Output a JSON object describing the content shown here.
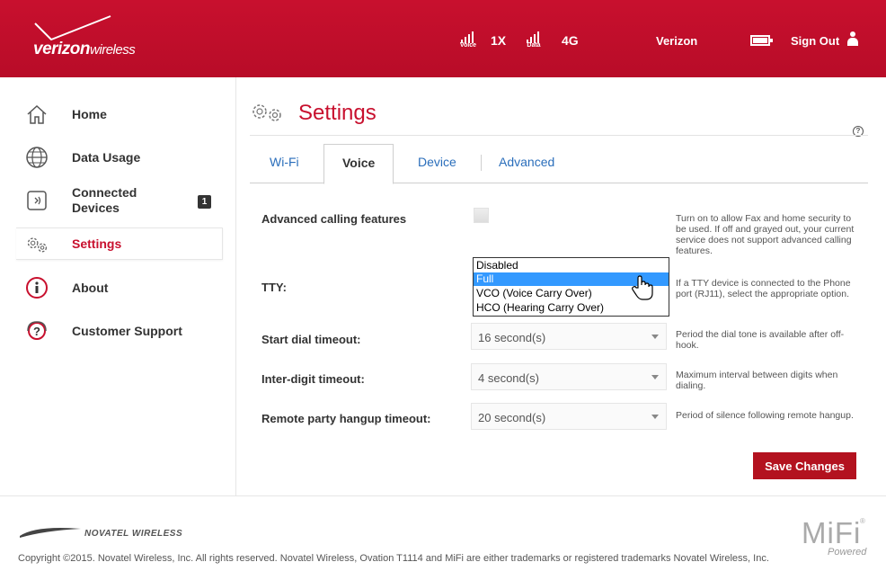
{
  "header": {
    "brand_bold": "verizon",
    "brand_light": "wireless",
    "voice_label": "Voice",
    "voice_network": "1X",
    "data_label": "Data",
    "data_network": "4G",
    "carrier": "Verizon",
    "sign_out": "Sign Out",
    "accent_color": "#c8102e"
  },
  "sidebar": {
    "items": [
      {
        "label": "Home",
        "icon": "home-icon"
      },
      {
        "label": "Data Usage",
        "icon": "globe-icon"
      },
      {
        "label": "Connected\nDevices",
        "icon": "devices-icon"
      },
      {
        "label": "Settings",
        "icon": "gears-icon",
        "active": true
      },
      {
        "label": "About",
        "icon": "info-icon"
      },
      {
        "label": "Customer Support",
        "icon": "support-icon"
      }
    ],
    "connected_count": "1"
  },
  "main": {
    "title": "Settings",
    "help": "?",
    "tabs": [
      {
        "label": "Wi-Fi"
      },
      {
        "label": "Voice",
        "active": true
      },
      {
        "label": "Device"
      },
      {
        "label": "Advanced"
      }
    ],
    "rows": {
      "advanced": {
        "label": "Advanced calling features",
        "help": "Turn on to allow Fax and home security to be used. If off and grayed out, your current service does not support advanced calling features.",
        "checked": false
      },
      "tty": {
        "label": "TTY:",
        "help": "If a TTY device is connected to the Phone port (RJ11), select the appropriate option.",
        "options": [
          "Disabled",
          "Full",
          "VCO (Voice Carry Over)",
          "HCO (Hearing Carry Over)"
        ],
        "highlighted": "Full"
      },
      "start_dial": {
        "label": "Start dial timeout:",
        "value": "16 second(s)",
        "help": "Period the dial tone is available after off-hook."
      },
      "inter_digit": {
        "label": "Inter-digit timeout:",
        "value": "4 second(s)",
        "help": "Maximum interval between digits when dialing."
      },
      "remote_hangup": {
        "label": "Remote party hangup timeout:",
        "value": "20 second(s)",
        "help": "Period of silence following remote hangup."
      }
    },
    "save_label": "Save Changes"
  },
  "footer": {
    "novatel": "NOVATEL WIRELESS",
    "copyright": "Copyright ©2015. Novatel Wireless, Inc. All rights reserved. Novatel Wireless, Ovation T1114 and MiFi are either trademarks or registered trademarks Novatel Wireless, Inc.",
    "mifi": "MiFi",
    "mifi_reg": "®",
    "powered": "Powered"
  }
}
